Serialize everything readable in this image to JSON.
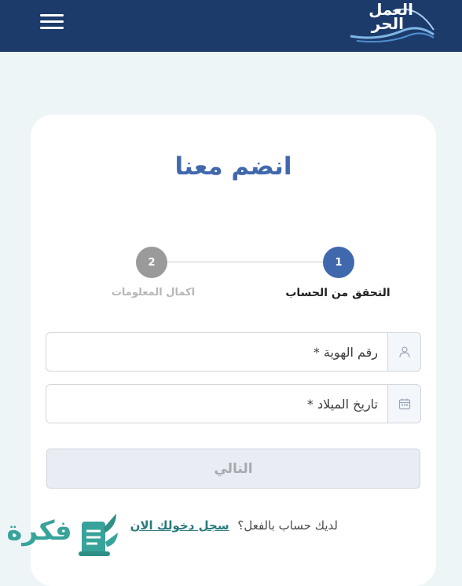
{
  "header": {
    "logo_line1": "العمل",
    "logo_line2": "الحر",
    "menu_icon": "hamburger-menu-icon",
    "background_color": "#1c3b6b"
  },
  "main": {
    "title": "انضم معنا",
    "steps": [
      {
        "number": "1",
        "label": "التحقق من الحساب",
        "state": "active",
        "color": "#4068ad"
      },
      {
        "number": "2",
        "label": "اكمال المعلومات",
        "state": "inactive",
        "color": "#9a9a9a"
      }
    ],
    "fields": {
      "id_number": {
        "placeholder": "رقم الهوية *",
        "value": "",
        "icon": "user-icon"
      },
      "birth_date": {
        "placeholder": "تاريخ الميلاد *",
        "value": "",
        "icon": "calendar-icon"
      }
    },
    "next_button": "التالي",
    "signin_prompt": "لديك حساب بالفعل؟",
    "signin_link": "سجل دخولك الان"
  },
  "watermark": {
    "text": "فكرة",
    "icon": "document-leaf-icon",
    "color": "#38a39a"
  }
}
